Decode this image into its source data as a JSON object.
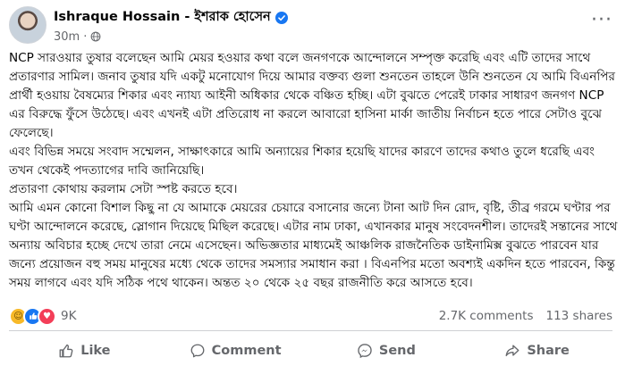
{
  "post": {
    "author": "Ishraque Hossain - ইশরাক হোসেন",
    "time": "30m",
    "dot": "·",
    "more": "···",
    "paragraphs": [
      "NCP সারওয়ার তুষার বলেছেন আমি মেয়র হওয়ার কথা বলে জনগণকে আন্দোলনে সম্পৃক্ত করেছি এবং এটি তাদের সাথে প্রতারণার সামিল। জনাব তুষার যদি একটু মনোযোগ দিয়ে আমার বক্তব্য গুলা শুনতেন তাহলে উনি শুনতেন যে আমি বিএনপির প্রার্থী হওয়ায় বৈষম্যের শিকার এবং ন্যায্য আইনী অধিকার থেকে বঞ্চিত হচ্ছি। এটা বুঝতে পেরেই ঢাকার সাধারণ জনগণ NCP এর বিরুদ্ধে ফুঁসে উঠেছে। এবং এখনই এটা প্রতিরোধ না করলে আবারো হাসিনা মার্কা জাতীয় নির্বাচন হতে পারে সেটাও বুঝে ফেলেছে।",
      "এবং বিভিন্ন সময়ে সংবাদ সম্মেলন, সাক্ষাৎকারে আমি অন্যায়ের শিকার হয়েছি যাদের কারণে তাদের কথাও তুলে ধরেছি এবং তখন থেকেই পদত্যাগের দাবি জানিয়েছি।",
      "প্রতারণা কোথায় করলাম সেটা স্পষ্ট করতে হবে।",
      "আমি এমন কোনো বিশাল কিছু না যে আমাকে মেয়রের চেয়ারে বসানোর জন্যে টানা আট দিন রোদ, বৃষ্টি, তীব্র গরমে ঘণ্টার পর ঘণ্টা আন্দোলনে করেছে, স্লোগান দিয়েছে মিছিল করেছে। এটার নাম ঢাকা, এখানকার মানুষ সংবেদনশীল। তাদেরই সন্তানের সাথে অন্যায় অবিচার হচ্ছে দেখে তারা নেমে এসেছেন। অভিজ্ঞতার মাধ্যমেই আঞ্চলিক রাজনৈতিক ডাইনামিক্স বুঝতে পারবেন যার জন্যে প্রয়োজন বহু সময় মানুষের মধ্যে থেকে তাদের সমস্যার সমাধান করা । বিএনপির মতো অবশ্যই একদিন হতে পারবেন, কিন্তু সময় লাগবে এবং যদি সঠিক পথে থাকেন। অন্তত ২০ থেকে ২৫ বছর রাজনীতি করে আসতে হবে।"
    ]
  },
  "stats": {
    "reactions": "9K",
    "comments": "2.7K comments",
    "shares": "113 shares",
    "reaction_icons": [
      "haha-icon",
      "like-icon",
      "love-icon"
    ]
  },
  "actions": {
    "like": "Like",
    "comment": "Comment",
    "send": "Send",
    "share": "Share"
  },
  "colors": {
    "accent": "#1877f2",
    "muted": "#65676b",
    "love": "#f33e58",
    "haha": "#f7b928"
  }
}
